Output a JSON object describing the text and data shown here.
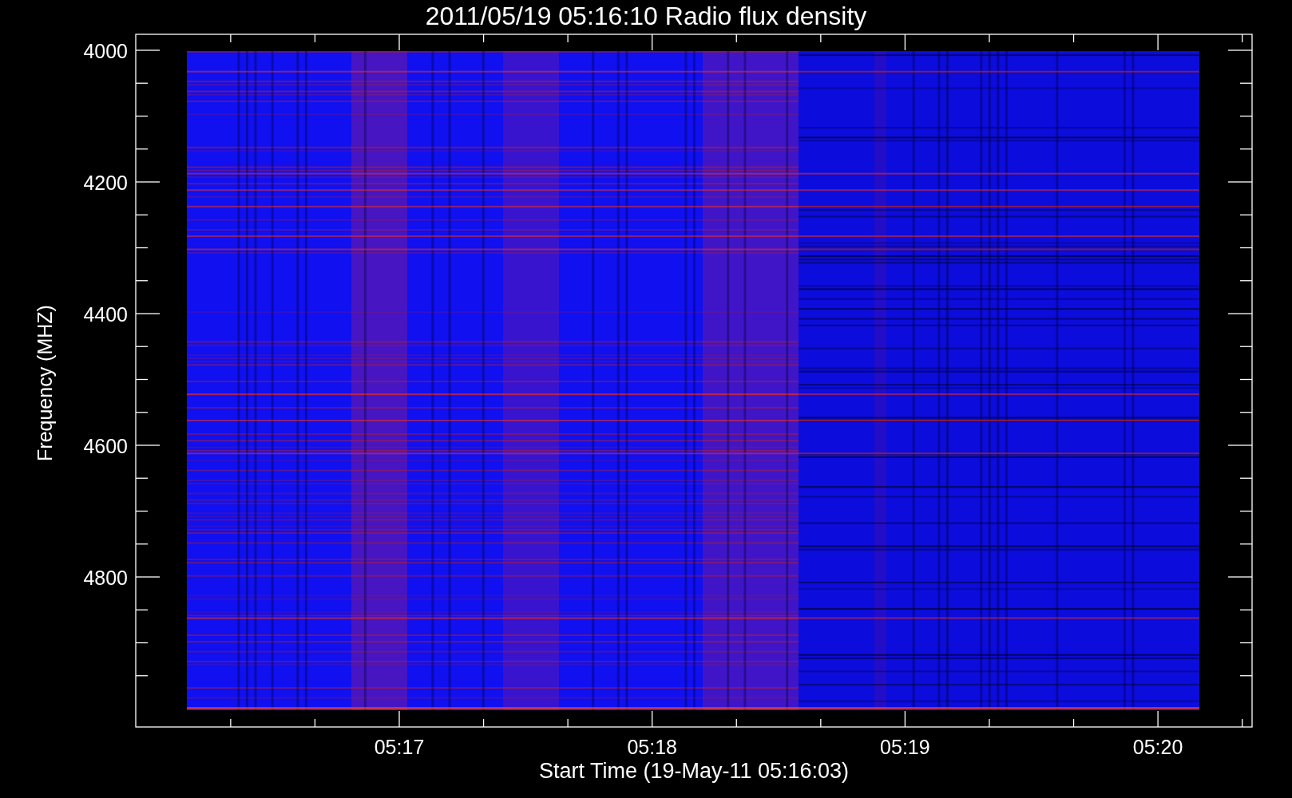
{
  "title": "2011/05/19 05:16:10 Radio flux density",
  "y_axis": {
    "label": "Frequency (MHZ)",
    "ticks": [
      "4000",
      "4200",
      "4400",
      "4600",
      "4800"
    ]
  },
  "x_axis": {
    "label": "Start Time (19-May-11 05:16:03)",
    "ticks": [
      "05:17",
      "05:18",
      "05:19",
      "05:20"
    ]
  }
}
